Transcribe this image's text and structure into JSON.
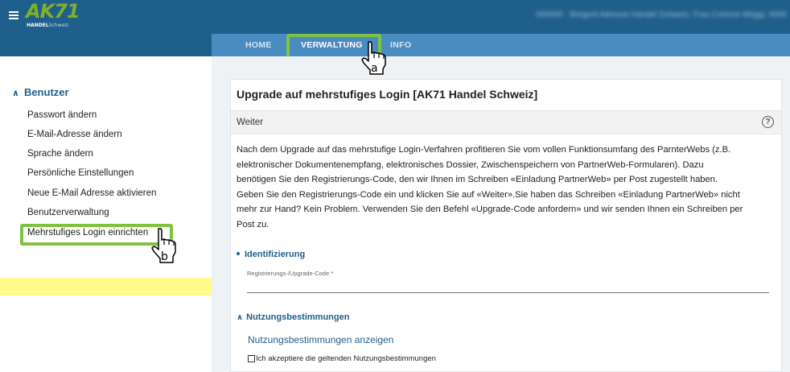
{
  "header": {
    "logo_main": "AK71",
    "logo_sub_a": "HANDEL",
    "logo_sub_b": "Schweiz",
    "user_info": "000000 · Bürgerli Adresse Handel Schweiz, Frau Corinne Müggi, 0000"
  },
  "nav": {
    "tabs": [
      {
        "label": "HOME"
      },
      {
        "label": "VERWALTUNG"
      },
      {
        "label": "INFO"
      }
    ],
    "active": "VERWALTUNG"
  },
  "sidebar": {
    "heading": "Benutzer",
    "items": [
      {
        "label": "Passwort ändern"
      },
      {
        "label": "E-Mail-Adresse ändern"
      },
      {
        "label": "Sprache ändern"
      },
      {
        "label": "Persönliche Einstellungen"
      },
      {
        "label": "Neue E-Mail Adresse aktivieren"
      },
      {
        "label": "Benutzerverwaltung"
      },
      {
        "label": "Mehrstufiges Login einrichten"
      }
    ]
  },
  "panel": {
    "title": "Upgrade auf mehrstufiges Login [AK71 Handel Schweiz]",
    "subhead": "Weiter",
    "intro_lines": [
      "Nach dem Upgrade auf das mehrstufige Login-Verfahren profitieren Sie vom vollen Funktionsumfang des ParnterWebs (z.B.",
      "elektronischer Dokumentenempfang, elektronisches Dossier, Zwischenspeichern von PartnerWeb-Formularen). Dazu",
      "benötigen Sie den Registrierungs-Code, den wir Ihnen im Schreiben «Einladung PartnerWeb» per Post zugestellt haben.",
      "Geben Sie den Registrierungs-Code ein und klicken Sie auf «Weiter».Sie haben das Schreiben «Einladung PartnerWeb» nicht",
      "mehr zur Hand? Kein Problem. Verwenden Sie den Befehl «Upgrade-Code anfordern» und wir senden Ihnen ein Schreiben per",
      "Post zu."
    ],
    "ident_heading": "Identifizierung",
    "code_label": "Registrierungs-/Upgrade-Code *",
    "terms_heading": "Nutzungsbestimmungen",
    "terms_link": "Nutzungsbestimmungen anzeigen",
    "terms_checkbox": "Ich akzeptiere die geltenden Nutzungsbestimmungen"
  },
  "annotations": {
    "cursor_a": "a",
    "cursor_b": "b"
  },
  "colors": {
    "header": "#1f5f8b",
    "navbar": "#4a8cbf",
    "highlight_border": "#7fc241",
    "highlight_fill": "#fffb8a",
    "link": "#1f5f8b"
  }
}
